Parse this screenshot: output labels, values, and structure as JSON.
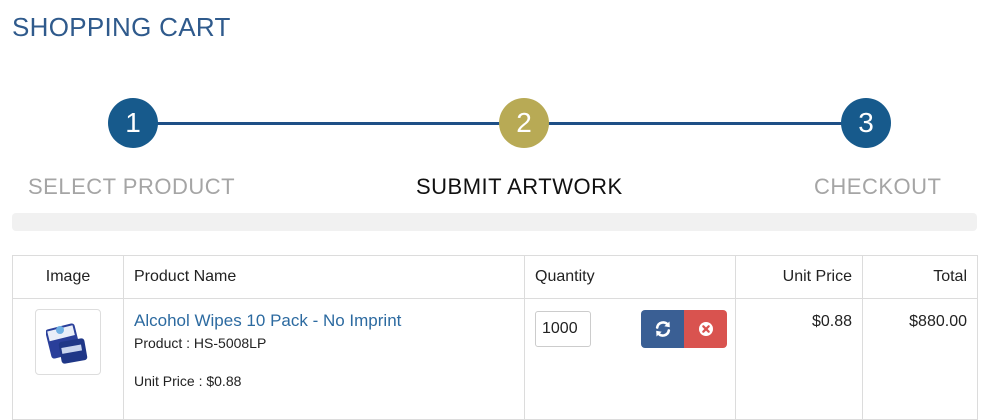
{
  "page": {
    "title": "SHOPPING CART"
  },
  "steps": [
    {
      "number": "1",
      "label": "SELECT PRODUCT",
      "state": "done",
      "color": "#175a8c"
    },
    {
      "number": "2",
      "label": "SUBMIT ARTWORK",
      "state": "current",
      "color": "#b8aa55"
    },
    {
      "number": "3",
      "label": "CHECKOUT",
      "state": "pending",
      "color": "#175a8c"
    }
  ],
  "table": {
    "headers": {
      "image": "Image",
      "name": "Product Name",
      "quantity": "Quantity",
      "unit_price": "Unit Price",
      "total": "Total"
    },
    "rows": [
      {
        "product_name": "Alcohol Wipes 10 Pack - No Imprint",
        "product_code": "Product : HS-5008LP",
        "unit_price_line": "Unit Price : $0.88",
        "quantity": "1000",
        "unit_price": "$0.88",
        "total": "$880.00",
        "update_icon": "refresh-icon",
        "remove_icon": "remove-circle-icon"
      }
    ]
  },
  "colors": {
    "accent": "#2f5a8c",
    "link": "#2c6aa0",
    "update_button": "#3a5f94",
    "remove_button": "#d9534f"
  }
}
